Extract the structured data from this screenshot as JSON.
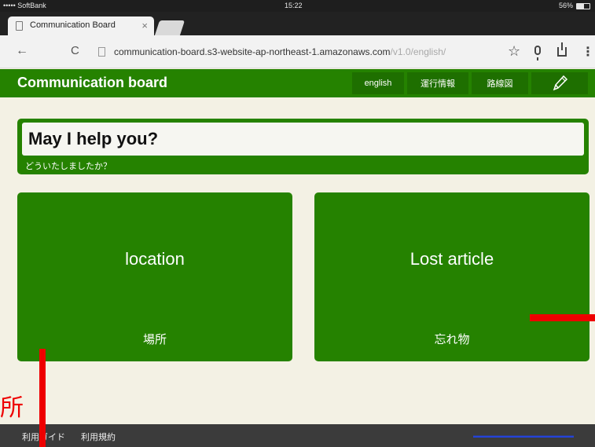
{
  "status_bar": {
    "carrier": "••••• SoftBank",
    "time": "15:22",
    "battery": "56%",
    "battery_level": 0.56
  },
  "browser": {
    "tab_title": "Communication Board",
    "url_host": "communication-board.s3-website-ap-northeast-1.amazonaws.com",
    "url_path": "/v1.0/english/"
  },
  "header": {
    "brand": "Communication board",
    "nav": {
      "english": "english",
      "operations": "運行情報",
      "route_map": "路線図"
    }
  },
  "question": {
    "text": "May I help you?",
    "subtitle": "どういたしましたか？"
  },
  "cards": [
    {
      "title": "location",
      "subtitle": "場所"
    },
    {
      "title": "Lost article",
      "subtitle": "忘れ物"
    }
  ],
  "annotation": {
    "glyph": "所",
    "color": "#ee0000"
  },
  "footer": {
    "guide": "利用ガイド",
    "terms": "利用規約"
  },
  "colors": {
    "brand_green": "#258200",
    "background": "#f3f1e4"
  }
}
